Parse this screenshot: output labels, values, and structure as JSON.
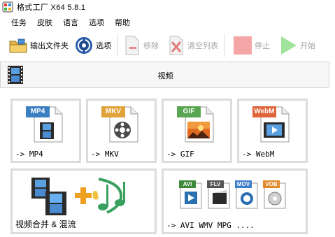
{
  "window": {
    "title": "格式工厂 X64 5.8.1"
  },
  "menu": [
    "任务",
    "皮肤",
    "语言",
    "选项",
    "帮助"
  ],
  "toolbar": {
    "output_folder": "输出文件夹",
    "options": "选项",
    "remove": "移除",
    "clear_list": "清空列表",
    "stop": "停止",
    "start": "开始"
  },
  "category": {
    "title": "视频"
  },
  "tiles": {
    "mp4": {
      "tag": "MP4",
      "label": "-> MP4"
    },
    "mkv": {
      "tag": "MKV",
      "label": "-> MKV"
    },
    "gif": {
      "tag": "GIF",
      "label": "-> GIF"
    },
    "webm": {
      "tag": "WebM",
      "label": "-> WebM"
    },
    "merge": {
      "label": "视频合并 & 混流"
    },
    "multi": {
      "tags": [
        "AVI",
        "FLV",
        "MOV",
        "VOB"
      ],
      "label": "-> AVI WMV MPG ...."
    }
  },
  "colors": {
    "mp4": "#3a7fc1",
    "mkv": "#e1a23a",
    "gif": "#5aa552",
    "webm": "#e0643a",
    "avi": "#3d8a3a",
    "flv": "#555555",
    "mov": "#3d7fc8",
    "vob": "#e08a2a"
  }
}
